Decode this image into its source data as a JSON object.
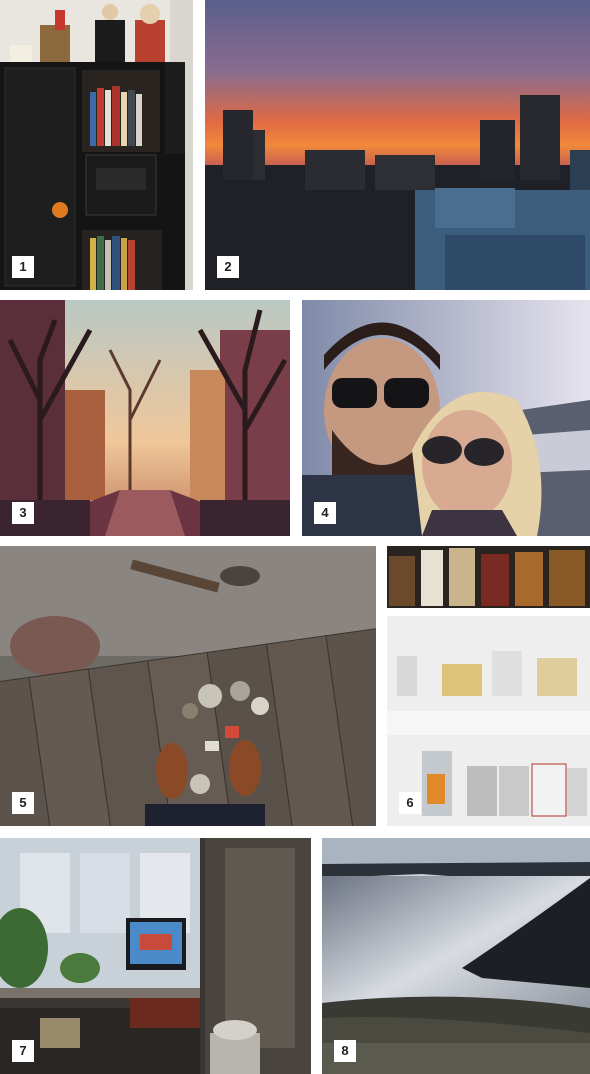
{
  "collage": {
    "photos": [
      {
        "number": "1"
      },
      {
        "number": "2"
      },
      {
        "number": "3"
      },
      {
        "number": "4"
      },
      {
        "number": "5"
      },
      {
        "number": "6"
      },
      {
        "number": "7"
      },
      {
        "number": "8"
      }
    ],
    "colors": {
      "background": "#ffffff",
      "badge_bg": "#ffffff",
      "badge_text": "#222222"
    }
  }
}
